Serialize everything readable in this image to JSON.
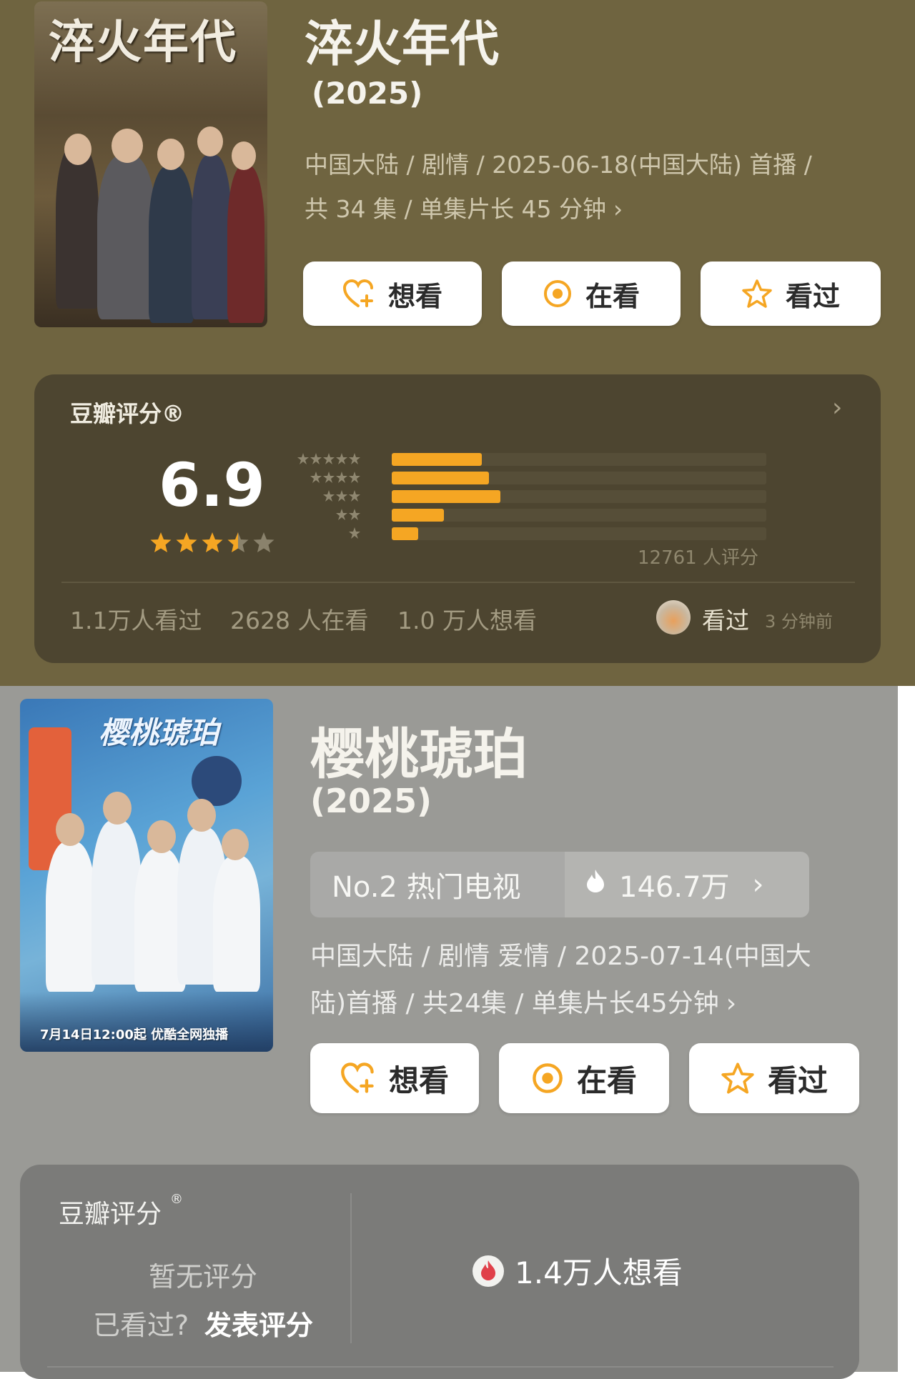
{
  "show1": {
    "title": "淬火年代",
    "year": "(2025)",
    "poster_title": "淬火年代",
    "meta_line1": "中国大陆 / 剧情 / 2025-06-18(中国大陆) 首播 /",
    "meta_line2": "共 34 集 / 单集片长 45 分钟",
    "buttons": {
      "want": "想看",
      "watching": "在看",
      "watched": "看过"
    },
    "rating": {
      "label": "豆瓣评分®",
      "score": "6.9",
      "stars": 3.5,
      "distribution_percent": [
        24,
        26,
        29,
        14,
        7
      ],
      "count_text": "12761 人评分"
    },
    "stats": {
      "watched": "1.1万人看过",
      "watching": "2628 人在看",
      "want": "1.0 万人想看"
    },
    "activity": {
      "action": "看过",
      "time": "3 分钟前"
    }
  },
  "show2": {
    "title": "樱桃琥珀",
    "year": "(2025)",
    "poster_title": "樱桃琥珀",
    "poster_caption": "7月14日12:00起 优酷全网独播",
    "rank": "No.2 热门电视",
    "heat": "146.7万",
    "meta_line1": "中国大陆 / 剧情 爱情 / 2025-07-14(中国大",
    "meta_line2": "陆)首播 / 共24集 / 单集片长45分钟",
    "buttons": {
      "want": "想看",
      "watching": "在看",
      "watched": "看过"
    },
    "rating": {
      "label": "豆瓣评分",
      "status": "暂无评分",
      "prompt": "已看过?",
      "action": "发表评分",
      "want_count": "1.4万人想看"
    }
  },
  "colors": {
    "accent_orange": "#f5a623",
    "star_orange": "#f5a623",
    "flame_red": "#e0404a"
  }
}
